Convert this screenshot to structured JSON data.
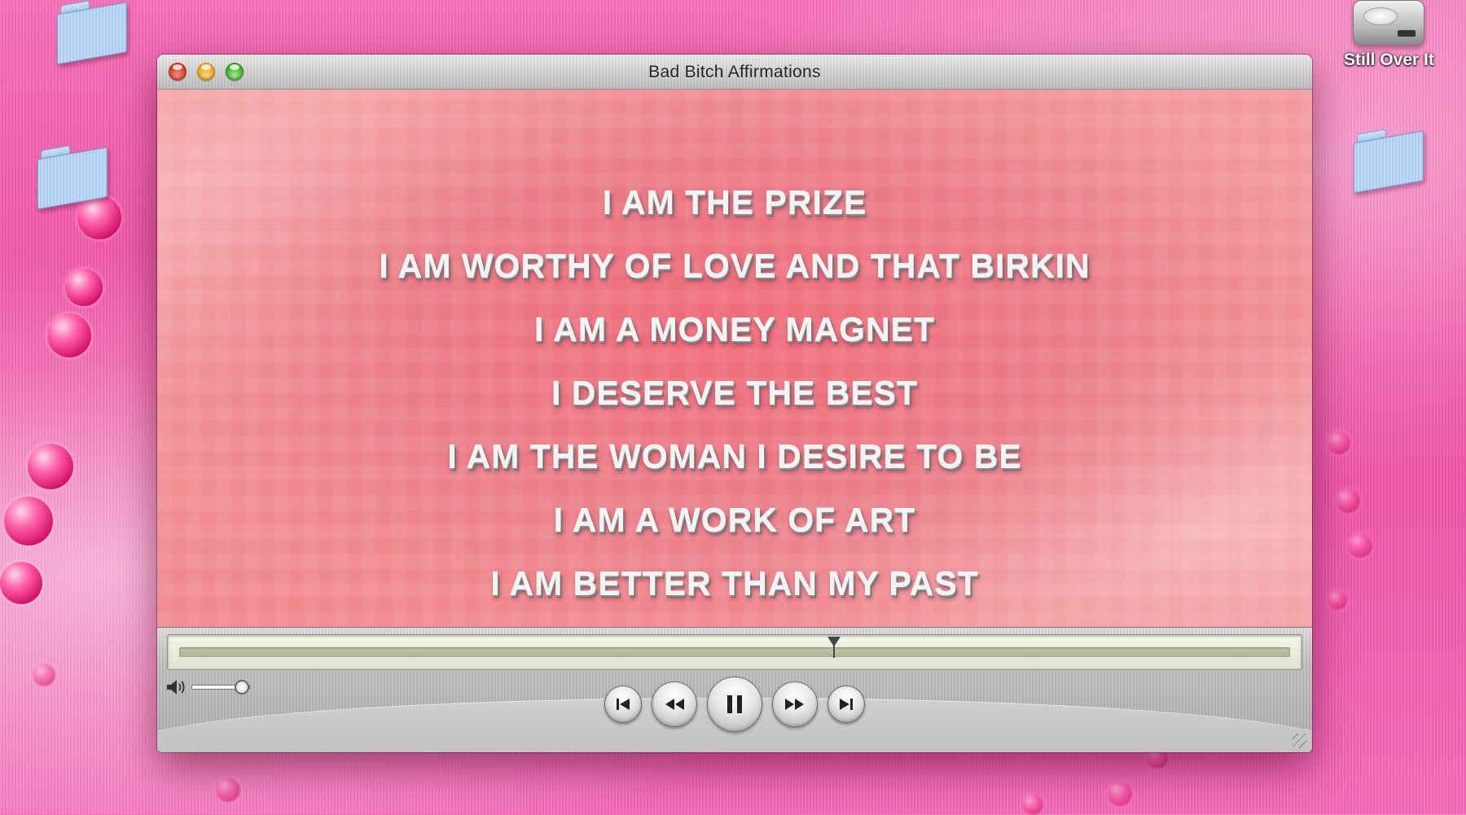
{
  "window": {
    "title": "Bad Bitch Affirmations",
    "buttons": {
      "close": "close",
      "minimize": "minimize",
      "zoom": "zoom"
    }
  },
  "video": {
    "affirmations": [
      "I AM THE PRIZE",
      "I AM WORTHY OF LOVE AND THAT BIRKIN",
      "I AM A MONEY MAGNET",
      "I DESERVE THE BEST",
      "I AM THE WOMAN I DESIRE TO BE",
      "I AM A WORK OF ART",
      "I AM BETTER THAN MY PAST"
    ]
  },
  "playback": {
    "progress": 0.588,
    "volume": 0.85,
    "state": "playing"
  },
  "desktop": {
    "drive_label": "Still Over It"
  },
  "icons": {
    "folder": "folder-icon",
    "drive": "hard-drive-icon",
    "speaker": "speaker-icon",
    "previous": "skip-back-icon",
    "rewind": "rewind-icon",
    "pause": "pause-icon",
    "fast_forward": "fast-forward-icon",
    "next": "skip-forward-icon"
  },
  "colors": {
    "desktop_pink": "#ee4ea2",
    "video_bg": "#f0888d",
    "close": "#d22a1a",
    "minimize": "#e39a12",
    "zoom": "#2c9d1c"
  }
}
